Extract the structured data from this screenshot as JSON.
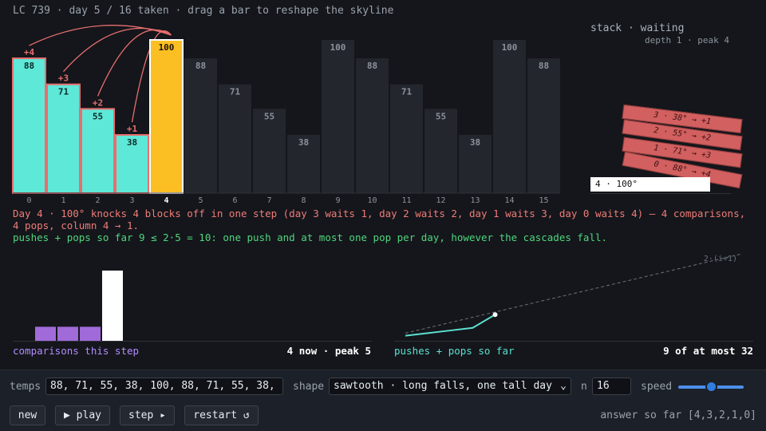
{
  "title": "LC 739 · day 5 / 16 taken · drag a bar to reshape the skyline",
  "skyline": {
    "temps": [
      88,
      71,
      55,
      38,
      100,
      88,
      71,
      55,
      38,
      100,
      88,
      71,
      55,
      38,
      100,
      88
    ],
    "max_temp": 100,
    "current_index": 4,
    "popped_indices": [
      0,
      1,
      2,
      3
    ],
    "stack_indices": [],
    "pending_waits": {
      "0": "+4",
      "1": "+3",
      "2": "+2",
      "3": "+1"
    },
    "colors": {
      "popped": "#5ee8d8",
      "popped_border": "#e86e6e",
      "current": "#fbbf24",
      "future": "#23262d",
      "future_text": "#8b929c",
      "arc": "#e86e6e",
      "day_label": "#8b949e"
    }
  },
  "stack": {
    "title": "stack · waiting",
    "subtitle": "depth 1 · peak 4",
    "popping": [
      "3 · 38° → +1",
      "2 · 55° → +2",
      "1 · 71° → +3",
      "0 · 88° → +4"
    ],
    "current": "4 · 100°"
  },
  "messages": {
    "line1": "Day 4 · 100° knocks 4 blocks off in one step (day 3 waits 1, day 2 waits 2, day 1 waits 3, day 0 waits 4) — 4 comparisons, 4 pops, column 4 → 1.",
    "line2": "pushes + pops so far 9 ≤ 2·5 = 10: one push and at most one pop per day, however the cascades fall."
  },
  "comparisons_panel": {
    "label": "comparisons this step",
    "summary": "4 now · peak 5",
    "bars": [
      0,
      1,
      1,
      1,
      5
    ],
    "max": 5,
    "colors": {
      "past": "#a06bd8",
      "current": "#ffffff"
    }
  },
  "pushpop_panel": {
    "label": "pushes + pops so far",
    "summary": "9 of at most 32",
    "bound_label": "2·(i+1)",
    "days_total": 16,
    "bound_max": 32,
    "series": [
      1,
      2,
      3,
      4,
      9
    ],
    "color": "#5ce0d0"
  },
  "controls": {
    "temps_label": "temps",
    "temps_value": "88, 71, 55, 38, 100, 88, 71, 55, 38, 100, 88, 71, 55, 38, 100, 88",
    "shape_label": "shape",
    "shape_value": "sawtooth · long falls, one tall day",
    "n_label": "n",
    "n_value": "16",
    "speed_label": "speed",
    "speed_value": 0.5,
    "buttons": {
      "new": "new",
      "play": "▶ play",
      "step": "step ▸",
      "restart": "restart ↺"
    },
    "answer": "answer so far [4,3,2,1,0]"
  }
}
